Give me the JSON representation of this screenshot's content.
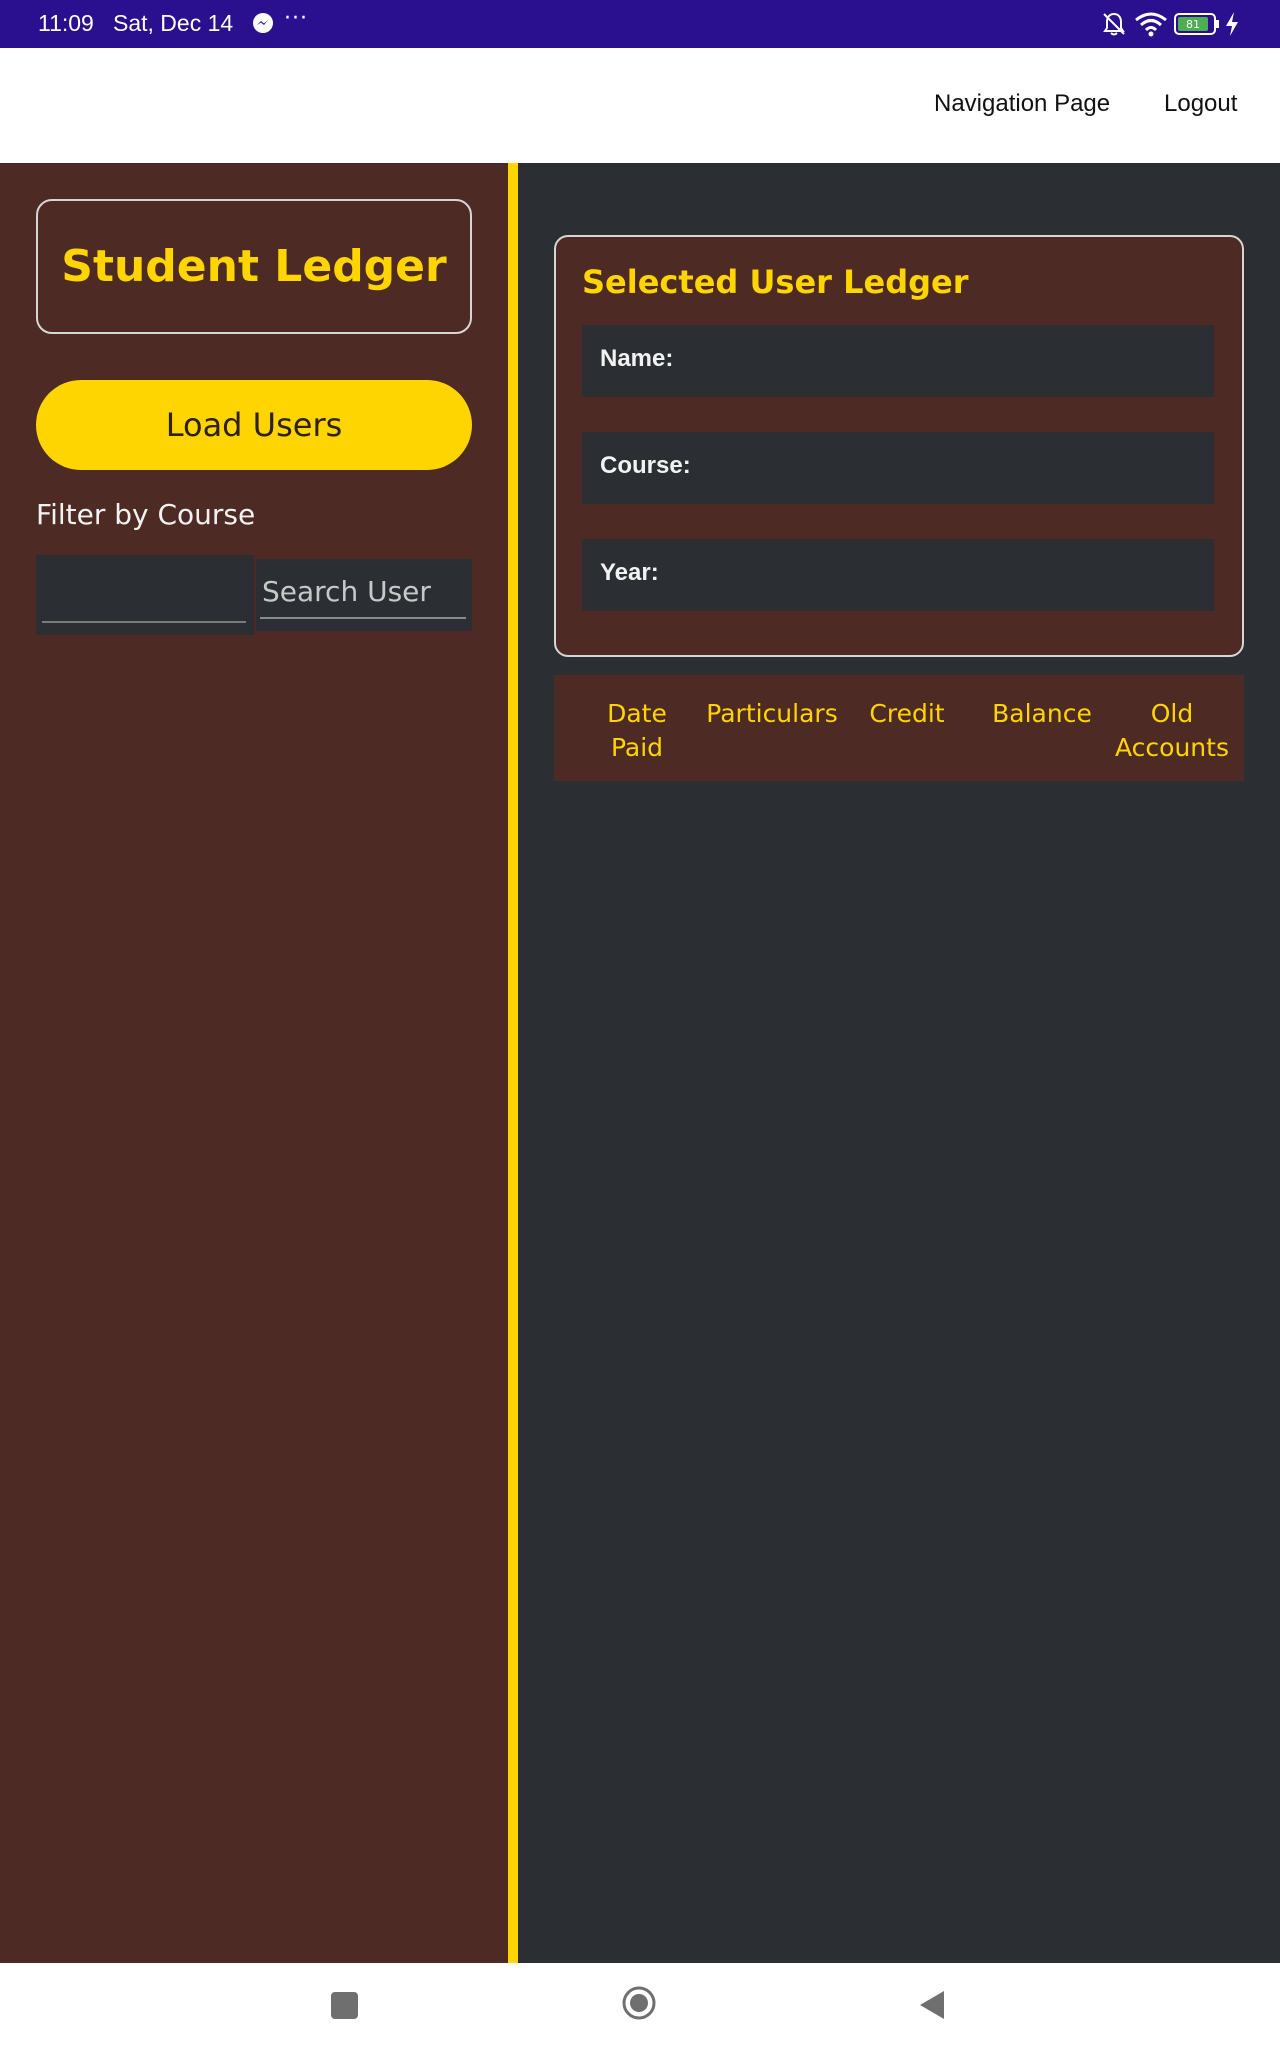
{
  "status_bar": {
    "time": "11:09",
    "date": "Sat, Dec 14",
    "more": "···",
    "battery": "81",
    "icons": [
      "messenger-icon",
      "bell-off-icon",
      "wifi-icon",
      "battery-icon",
      "charging-icon"
    ]
  },
  "header": {
    "nav_links": [
      "Navigation Page",
      "Logout"
    ]
  },
  "sidebar": {
    "title": "Student Ledger",
    "load_button": "Load Users",
    "filter_label": "Filter by Course",
    "course_value": "",
    "search_placeholder": "Search User"
  },
  "main": {
    "card_title": "Selected User Ledger",
    "fields": {
      "name_label": "Name:",
      "course_label": "Course:",
      "year_label": "Year:"
    },
    "table_headers": [
      "Date Paid",
      "Particulars",
      "Credit",
      "Balance",
      "Old Accounts"
    ],
    "table_rows": []
  },
  "colors": {
    "status_bar": "#2a0f8e",
    "sidebar_bg": "#4e2a24",
    "accent": "#ffd500",
    "panel_bg": "#2b2e32"
  },
  "nav_bar": {
    "icons": [
      "recents-icon",
      "home-icon",
      "back-icon"
    ]
  }
}
